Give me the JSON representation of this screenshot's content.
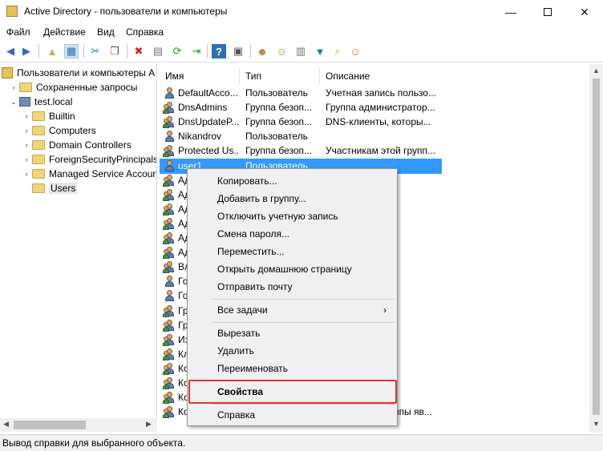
{
  "window": {
    "title": "Active Directory - пользователи и компьютеры",
    "minimize": "—",
    "close": "✕"
  },
  "menu": [
    "Файл",
    "Действие",
    "Вид",
    "Справка"
  ],
  "toolbar_icons": [
    "back-icon",
    "forward-icon",
    "up-folder-icon",
    "show-tree-icon",
    "cut-icon",
    "copy-icon",
    "delete-icon",
    "properties-icon",
    "refresh-icon",
    "export-icon",
    "help-icon",
    "console-icon",
    "add-user-icon",
    "add-group-icon",
    "add-ou-icon",
    "filter-icon",
    "find-icon",
    "add-to-group-icon"
  ],
  "tree": {
    "root": "Пользователи и компьютеры А",
    "saved_queries": "Сохраненные запросы",
    "domain": "test.local",
    "containers": [
      "Builtin",
      "Computers",
      "Domain Controllers",
      "ForeignSecurityPrincipals",
      "Managed Service Accounts",
      "Users"
    ],
    "selected": "Users"
  },
  "columns": {
    "name": "Имя",
    "type": "Тип",
    "description": "Описание"
  },
  "rows": [
    {
      "name": "DefaultAcco...",
      "type": "Пользователь",
      "desc": "Учетная запись пользо...",
      "icon": "user"
    },
    {
      "name": "DnsAdmins",
      "type": "Группа безоп...",
      "desc": "Группа администратор...",
      "icon": "group"
    },
    {
      "name": "DnsUpdateP...",
      "type": "Группа безоп...",
      "desc": "DNS-клиенты, которы...",
      "icon": "group"
    },
    {
      "name": "Nikandrov",
      "type": "Пользователь",
      "desc": "",
      "icon": "user"
    },
    {
      "name": "Protected Us...",
      "type": "Группа безоп...",
      "desc": "Участникам этой групп...",
      "icon": "group"
    },
    {
      "name": "user1",
      "type": "Пользователь",
      "desc": "",
      "icon": "user",
      "selected": true
    },
    {
      "name": "Ад",
      "type": "",
      "desc": "етная запи...",
      "icon": "group"
    },
    {
      "name": "Ад",
      "type": "",
      "desc": "дминис...",
      "icon": "group"
    },
    {
      "name": "Ад",
      "type": "",
      "desc": "ы этой групп...",
      "icon": "group"
    },
    {
      "name": "Ад",
      "type": "",
      "desc": "ы этой групп...",
      "icon": "group"
    },
    {
      "name": "Ад",
      "type": "",
      "desc": "дминис...",
      "icon": "group"
    },
    {
      "name": "Ад",
      "type": "",
      "desc": "дминис...",
      "icon": "group"
    },
    {
      "name": "Вл",
      "type": "",
      "desc": "ы этой групп...",
      "icon": "group"
    },
    {
      "name": "Го",
      "type": "",
      "desc": "а",
      "icon": "user"
    },
    {
      "name": "Го",
      "type": "",
      "desc": "етная запи...",
      "icon": "user"
    },
    {
      "name": "Гр",
      "type": "",
      "desc": "ы этой групп...",
      "icon": "group"
    },
    {
      "name": "Гр",
      "type": "",
      "desc": "ы этой групп...",
      "icon": "group"
    },
    {
      "name": "Из",
      "type": "",
      "desc": "ы этой групп...",
      "icon": "group"
    },
    {
      "name": "Кл",
      "type": "",
      "desc": "ы, яв...",
      "icon": "group"
    },
    {
      "name": "Ко",
      "type": "",
      "desc": "нции и...",
      "icon": "group"
    },
    {
      "name": "Ко",
      "type": "",
      "desc": "ы доме...",
      "icon": "group"
    },
    {
      "name": "Ко",
      "type": "",
      "desc": "ы, яв...",
      "icon": "group"
    },
    {
      "name": "Контроллер...",
      "type": "Группа безоп...",
      "desc": "Члены этой группы яв...",
      "icon": "group"
    }
  ],
  "context_menu": {
    "items": [
      "Копировать...",
      "Добавить в группу...",
      "Отключить учетную запись",
      "Смена пароля...",
      "Переместить...",
      "Открыть домашнюю страницу",
      "Отправить почту"
    ],
    "all_tasks": "Все задачи",
    "submenu_arrow": "›",
    "edit_items": [
      "Вырезать",
      "Удалить",
      "Переименовать"
    ],
    "properties": "Свойства",
    "help": "Справка"
  },
  "status": "Вывод справки для выбранного объекта.",
  "colors": {
    "selection": "#3399ff",
    "highlight_box": "#e03535"
  }
}
